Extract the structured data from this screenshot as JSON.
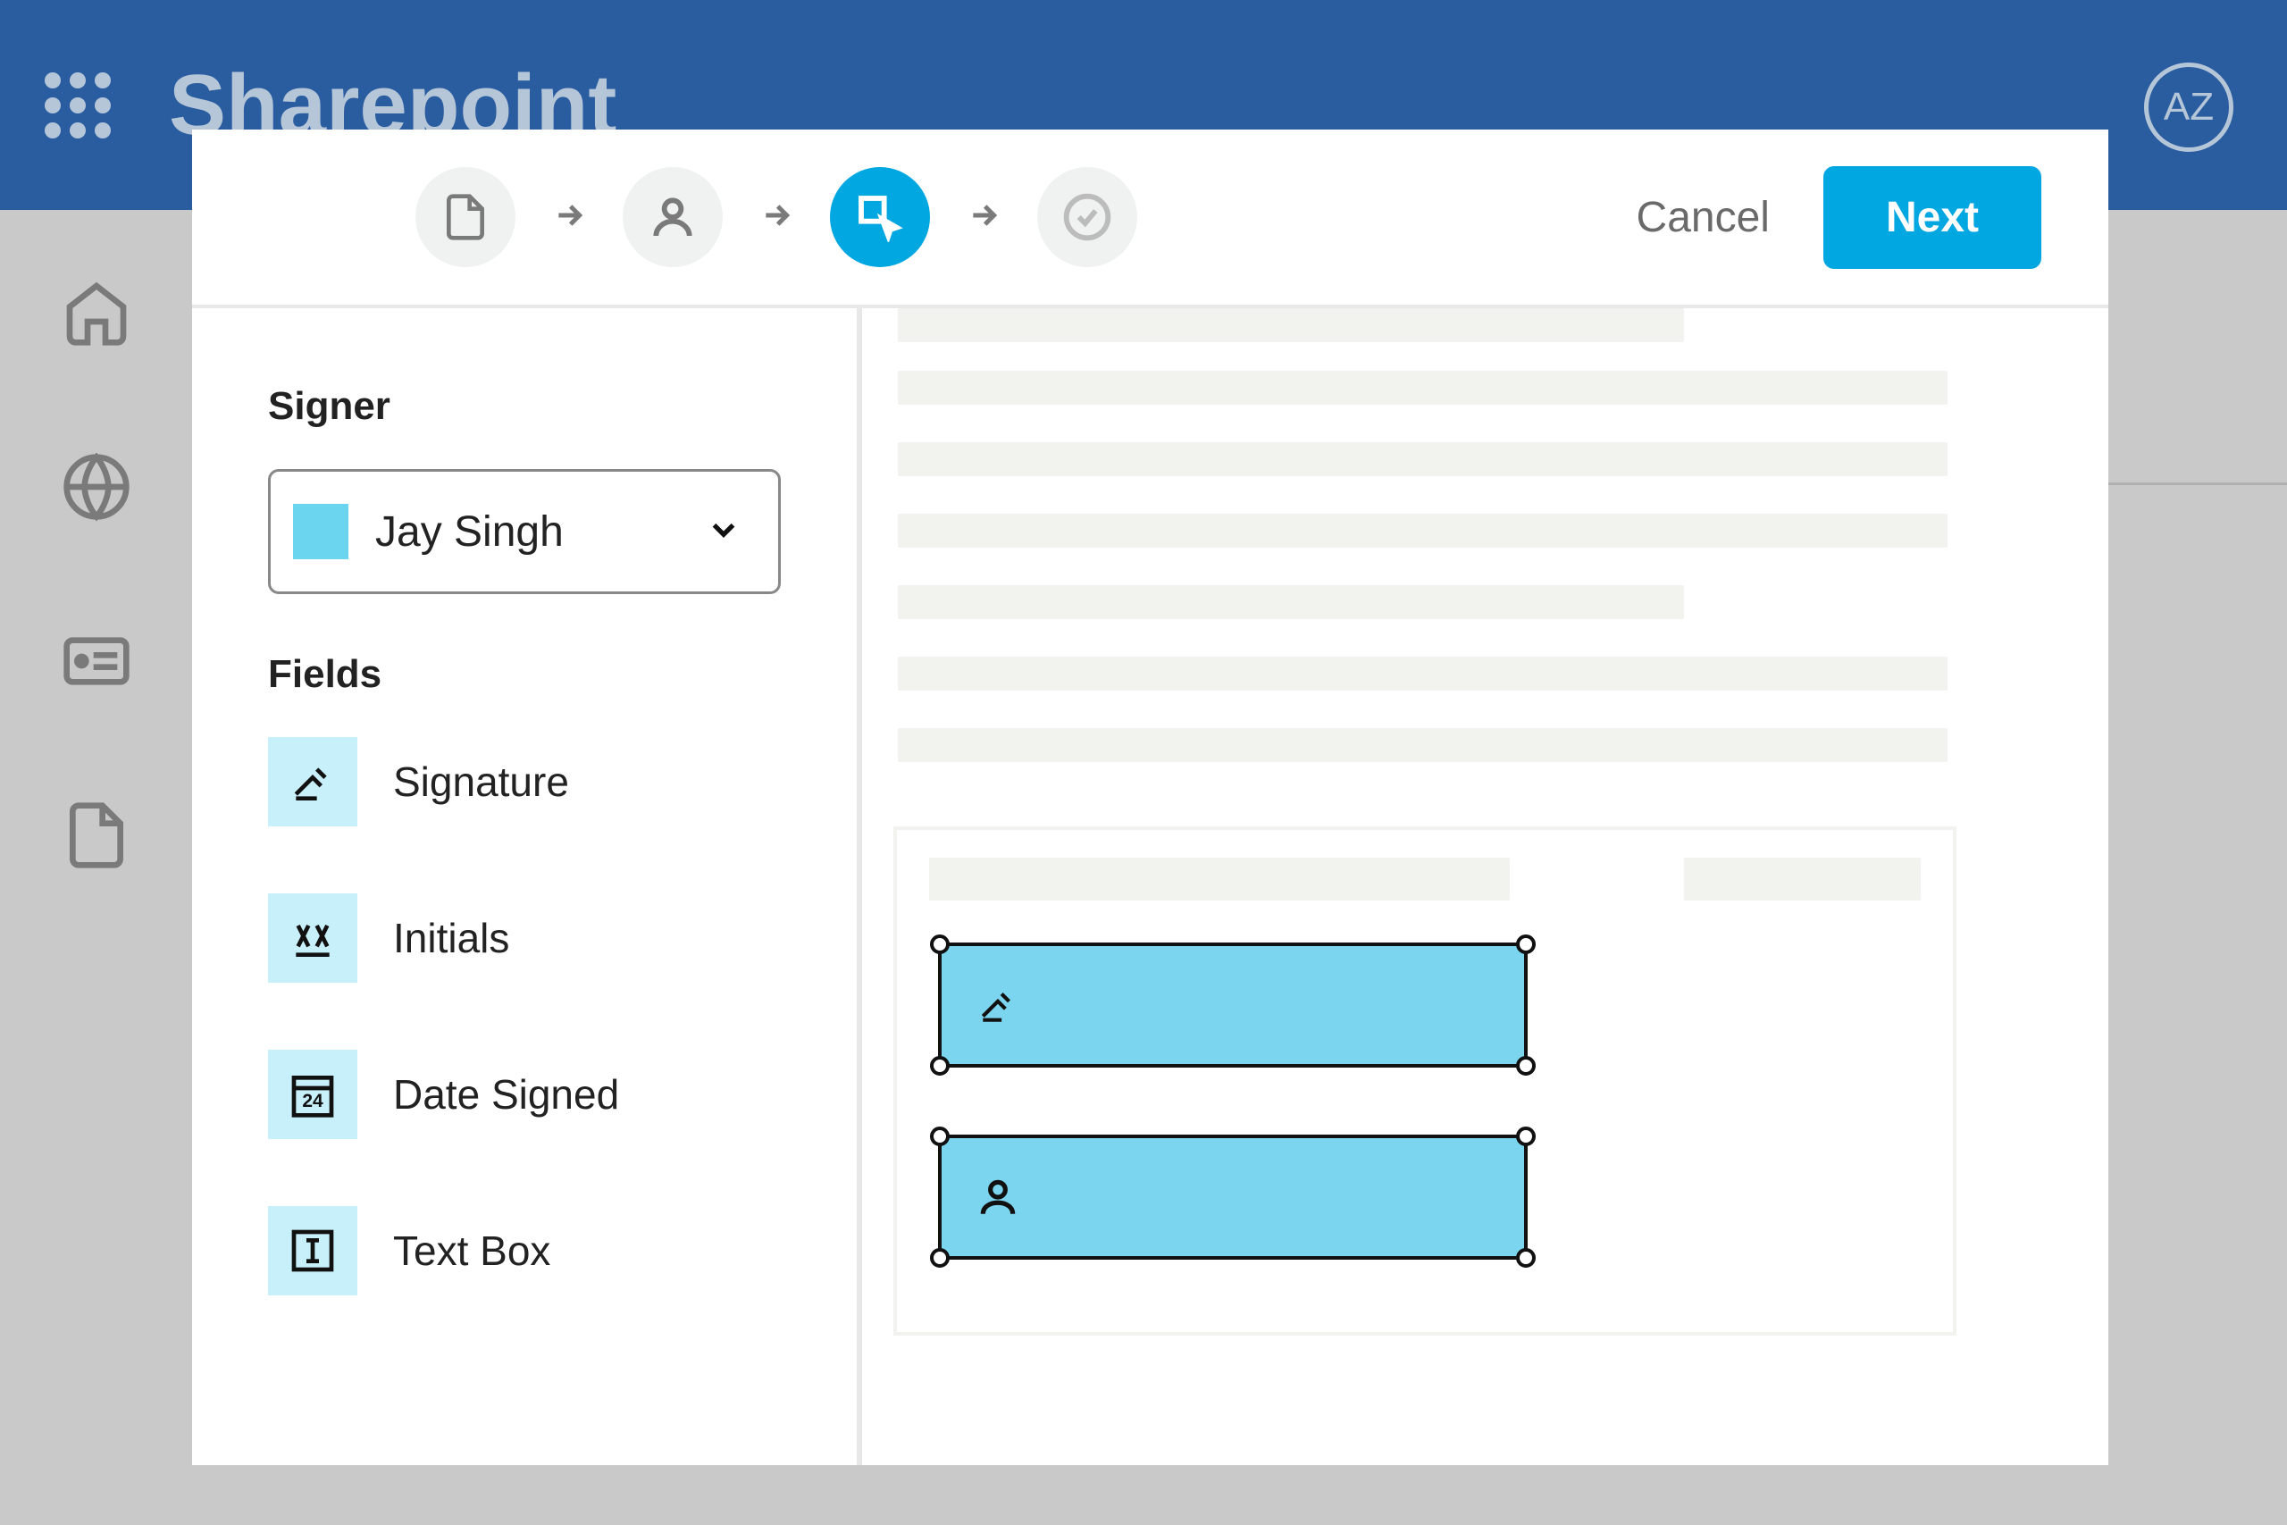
{
  "header": {
    "brand": "Sharepoint",
    "avatar_initials": "AZ"
  },
  "modal": {
    "cancel_label": "Cancel",
    "next_label": "Next",
    "sidebar": {
      "signer_title": "Signer",
      "signer_selected": "Jay Singh",
      "fields_title": "Fields",
      "fields": [
        {
          "label": "Signature",
          "icon": "signature"
        },
        {
          "label": "Initials",
          "icon": "initials"
        },
        {
          "label": "Date Signed",
          "icon": "date"
        },
        {
          "label": "Text Box",
          "icon": "textbox"
        }
      ]
    }
  }
}
